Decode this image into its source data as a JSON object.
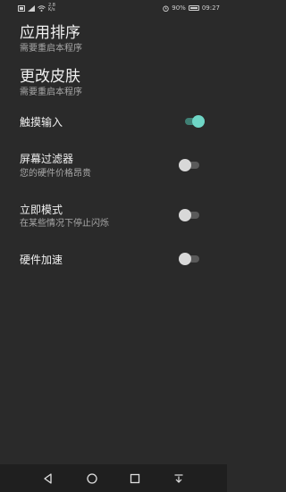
{
  "status_bar": {
    "net_speed_value": "2.8",
    "net_speed_unit": "K/s",
    "battery": "90%",
    "time": "09:27"
  },
  "settings": {
    "app_sort": {
      "title": "应用排序",
      "subtitle": "需要重启本程序"
    },
    "change_skin": {
      "title": "更改皮肤",
      "subtitle": "需要重启本程序"
    },
    "touch_input": {
      "title": "触摸输入",
      "enabled": true
    },
    "screen_filter": {
      "title": "屏幕过滤器",
      "subtitle": "您的硬件价格昂贵",
      "enabled": false
    },
    "instant_mode": {
      "title": "立即模式",
      "subtitle": "在某些情况下停止闪烁",
      "enabled": false
    },
    "hardware_accel": {
      "title": "硬件加速",
      "enabled": false
    }
  },
  "colors": {
    "background": "#2a2a2a",
    "toggle_on_thumb": "#6fd6c6",
    "toggle_on_track": "#3f7f74",
    "toggle_off_thumb": "#d8d8d8",
    "toggle_off_track": "#5a5a5a"
  },
  "icons": {
    "status_left": [
      "sim-icon",
      "signal-icon",
      "wifi-icon"
    ],
    "status_right": [
      "alarm-icon",
      "battery-icon"
    ],
    "nav": [
      "back-icon",
      "home-icon",
      "recents-icon",
      "notification-shade-icon"
    ]
  }
}
